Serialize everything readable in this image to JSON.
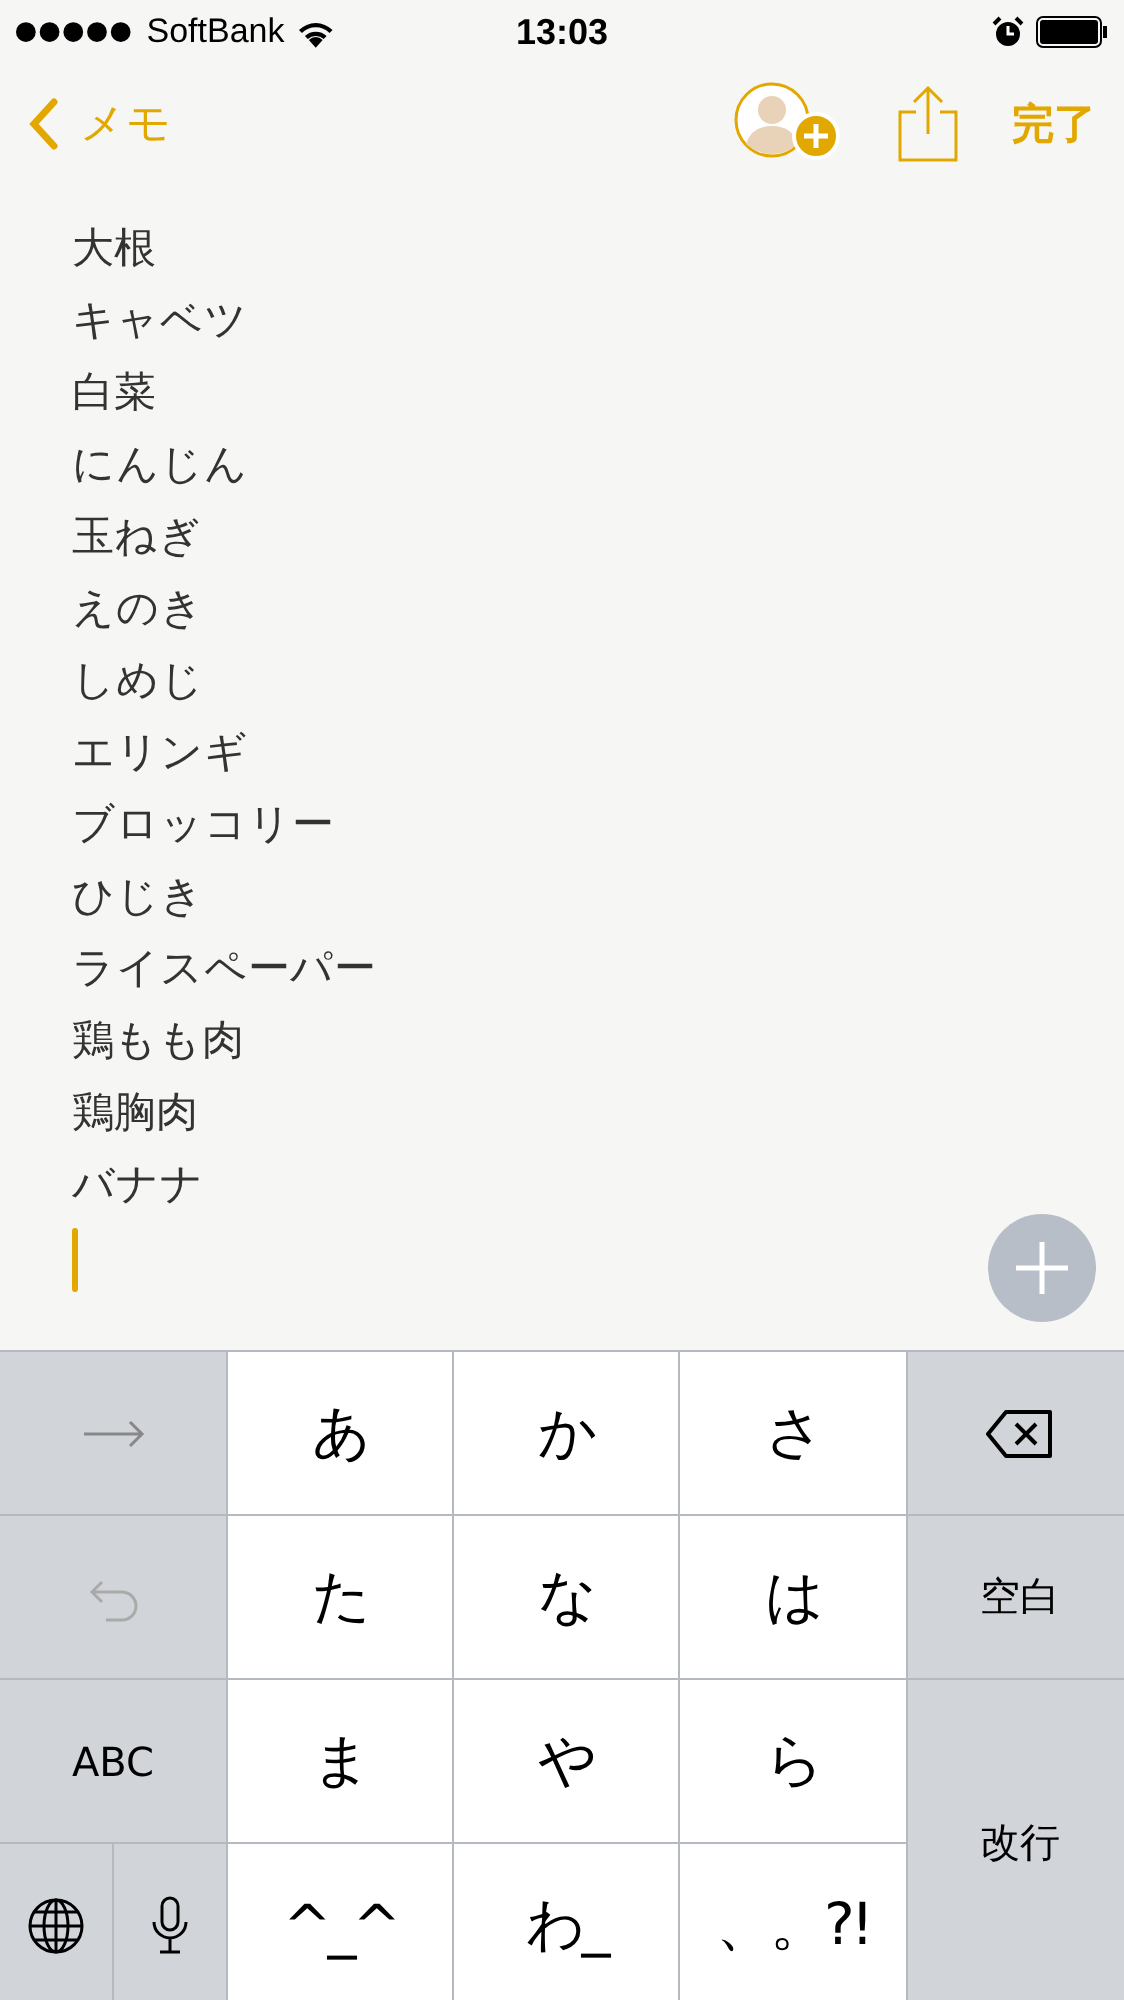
{
  "status_bar": {
    "carrier": "SoftBank",
    "time": "13:03"
  },
  "nav": {
    "back_label": "メモ",
    "done_label": "完了"
  },
  "note": {
    "lines": [
      "大根",
      "キャベツ",
      "白菜",
      "にんじん",
      "玉ねぎ",
      "えのき",
      "しめじ",
      "エリンギ",
      "ブロッコリー",
      "ひじき",
      "ライスペーパー",
      "鶏もも肉",
      "鶏胸肉",
      "バナナ"
    ]
  },
  "keyboard": {
    "keys": [
      {
        "kind": "arrow"
      },
      {
        "kind": "char",
        "label": "あ"
      },
      {
        "kind": "char",
        "label": "か"
      },
      {
        "kind": "char",
        "label": "さ"
      },
      {
        "kind": "delete"
      },
      {
        "kind": "undo"
      },
      {
        "kind": "char",
        "label": "た"
      },
      {
        "kind": "char",
        "label": "な"
      },
      {
        "kind": "char",
        "label": "は"
      },
      {
        "kind": "func",
        "label": "空白"
      },
      {
        "kind": "func",
        "label": "ABC"
      },
      {
        "kind": "char",
        "label": "ま"
      },
      {
        "kind": "char",
        "label": "や"
      },
      {
        "kind": "char",
        "label": "ら"
      },
      {
        "kind": "tall",
        "label": "改行"
      },
      {
        "kind": "split"
      },
      {
        "kind": "char",
        "label": "^_^"
      },
      {
        "kind": "char",
        "label": "わ_"
      },
      {
        "kind": "char",
        "label": "、。?!"
      }
    ]
  }
}
